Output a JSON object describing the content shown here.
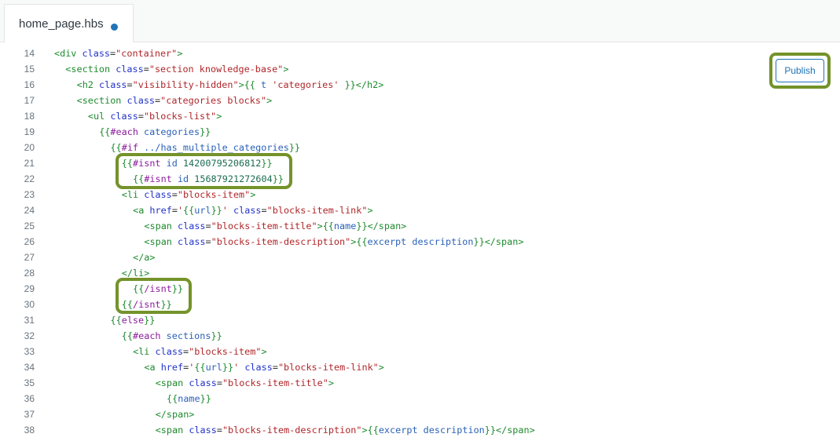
{
  "tab": {
    "filename": "home_page.hbs",
    "unsaved_indicator": "unsaved-dot"
  },
  "toolbar": {
    "publish_label": "Publish"
  },
  "colors": {
    "highlight": "#74932a",
    "accent": "#1f73b7"
  },
  "lines": [
    {
      "num": "14",
      "indent": 0,
      "tokens": [
        [
          "t",
          "<div "
        ],
        [
          "a",
          "class"
        ],
        [
          "o",
          "="
        ],
        [
          "s",
          "\"container\""
        ],
        [
          "t",
          ">"
        ]
      ]
    },
    {
      "num": "15",
      "indent": 2,
      "tokens": [
        [
          "t",
          "<section "
        ],
        [
          "a",
          "class"
        ],
        [
          "o",
          "="
        ],
        [
          "s",
          "\"section knowledge-base\""
        ],
        [
          "t",
          ">"
        ]
      ]
    },
    {
      "num": "16",
      "indent": 4,
      "tokens": [
        [
          "t",
          "<h2 "
        ],
        [
          "a",
          "class"
        ],
        [
          "o",
          "="
        ],
        [
          "s",
          "\"visibility-hidden\""
        ],
        [
          "t",
          ">"
        ],
        [
          "h",
          "{{ "
        ],
        [
          "v",
          "t "
        ],
        [
          "s",
          "'categories'"
        ],
        [
          "h",
          " }}"
        ],
        [
          "t",
          "</h2>"
        ]
      ]
    },
    {
      "num": "17",
      "indent": 4,
      "tokens": [
        [
          "t",
          "<section "
        ],
        [
          "a",
          "class"
        ],
        [
          "o",
          "="
        ],
        [
          "s",
          "\"categories blocks\""
        ],
        [
          "t",
          ">"
        ]
      ]
    },
    {
      "num": "18",
      "indent": 6,
      "tokens": [
        [
          "t",
          "<ul "
        ],
        [
          "a",
          "class"
        ],
        [
          "o",
          "="
        ],
        [
          "s",
          "\"blocks-list\""
        ],
        [
          "t",
          ">"
        ]
      ]
    },
    {
      "num": "19",
      "indent": 8,
      "tokens": [
        [
          "h",
          "{{"
        ],
        [
          "k",
          "#each "
        ],
        [
          "v",
          "categories"
        ],
        [
          "h",
          "}}"
        ]
      ]
    },
    {
      "num": "20",
      "indent": 10,
      "tokens": [
        [
          "h",
          "{{"
        ],
        [
          "k",
          "#if "
        ],
        [
          "v",
          "../has_multiple_categories"
        ],
        [
          "h",
          "}}"
        ]
      ]
    },
    {
      "num": "21",
      "indent": 12,
      "tokens": [
        [
          "h",
          "{{"
        ],
        [
          "k",
          "#isnt "
        ],
        [
          "v",
          "id "
        ],
        [
          "n",
          "14200795206812"
        ],
        [
          "h",
          "}}"
        ]
      ]
    },
    {
      "num": "22",
      "indent": 14,
      "tokens": [
        [
          "h",
          "{{"
        ],
        [
          "k",
          "#isnt "
        ],
        [
          "v",
          "id "
        ],
        [
          "n",
          "15687921272604"
        ],
        [
          "h",
          "}}"
        ]
      ]
    },
    {
      "num": "23",
      "indent": 12,
      "tokens": [
        [
          "t",
          "<li "
        ],
        [
          "a",
          "class"
        ],
        [
          "o",
          "="
        ],
        [
          "s",
          "\"blocks-item\""
        ],
        [
          "t",
          ">"
        ]
      ]
    },
    {
      "num": "24",
      "indent": 14,
      "tokens": [
        [
          "t",
          "<a "
        ],
        [
          "a",
          "href"
        ],
        [
          "o",
          "="
        ],
        [
          "s",
          "'"
        ],
        [
          "h",
          "{{"
        ],
        [
          "v",
          "url"
        ],
        [
          "h",
          "}}"
        ],
        [
          "s",
          "' "
        ],
        [
          "a",
          "class"
        ],
        [
          "o",
          "="
        ],
        [
          "s",
          "\"blocks-item-link\""
        ],
        [
          "t",
          ">"
        ]
      ]
    },
    {
      "num": "25",
      "indent": 16,
      "tokens": [
        [
          "t",
          "<span "
        ],
        [
          "a",
          "class"
        ],
        [
          "o",
          "="
        ],
        [
          "s",
          "\"blocks-item-title\""
        ],
        [
          "t",
          ">"
        ],
        [
          "h",
          "{{"
        ],
        [
          "v",
          "name"
        ],
        [
          "h",
          "}}"
        ],
        [
          "t",
          "</span>"
        ]
      ]
    },
    {
      "num": "26",
      "indent": 16,
      "tokens": [
        [
          "t",
          "<span "
        ],
        [
          "a",
          "class"
        ],
        [
          "o",
          "="
        ],
        [
          "s",
          "\"blocks-item-description\""
        ],
        [
          "t",
          ">"
        ],
        [
          "h",
          "{{"
        ],
        [
          "v",
          "excerpt description"
        ],
        [
          "h",
          "}}"
        ],
        [
          "t",
          "</span>"
        ]
      ]
    },
    {
      "num": "27",
      "indent": 14,
      "tokens": [
        [
          "t",
          "</a>"
        ]
      ]
    },
    {
      "num": "28",
      "indent": 12,
      "tokens": [
        [
          "t",
          "</li>"
        ]
      ]
    },
    {
      "num": "29",
      "indent": 14,
      "tokens": [
        [
          "h",
          "{{"
        ],
        [
          "k",
          "/isnt"
        ],
        [
          "h",
          "}}"
        ]
      ]
    },
    {
      "num": "30",
      "indent": 12,
      "tokens": [
        [
          "h",
          "{{"
        ],
        [
          "k",
          "/isnt"
        ],
        [
          "h",
          "}}"
        ]
      ]
    },
    {
      "num": "31",
      "indent": 10,
      "tokens": [
        [
          "h",
          "{{"
        ],
        [
          "k",
          "else"
        ],
        [
          "h",
          "}}"
        ]
      ]
    },
    {
      "num": "32",
      "indent": 12,
      "tokens": [
        [
          "h",
          "{{"
        ],
        [
          "k",
          "#each "
        ],
        [
          "v",
          "sections"
        ],
        [
          "h",
          "}}"
        ]
      ]
    },
    {
      "num": "33",
      "indent": 14,
      "tokens": [
        [
          "t",
          "<li "
        ],
        [
          "a",
          "class"
        ],
        [
          "o",
          "="
        ],
        [
          "s",
          "\"blocks-item\""
        ],
        [
          "t",
          ">"
        ]
      ]
    },
    {
      "num": "34",
      "indent": 16,
      "tokens": [
        [
          "t",
          "<a "
        ],
        [
          "a",
          "href"
        ],
        [
          "o",
          "="
        ],
        [
          "s",
          "'"
        ],
        [
          "h",
          "{{"
        ],
        [
          "v",
          "url"
        ],
        [
          "h",
          "}}"
        ],
        [
          "s",
          "' "
        ],
        [
          "a",
          "class"
        ],
        [
          "o",
          "="
        ],
        [
          "s",
          "\"blocks-item-link\""
        ],
        [
          "t",
          ">"
        ]
      ]
    },
    {
      "num": "35",
      "indent": 18,
      "tokens": [
        [
          "t",
          "<span "
        ],
        [
          "a",
          "class"
        ],
        [
          "o",
          "="
        ],
        [
          "s",
          "\"blocks-item-title\""
        ],
        [
          "t",
          ">"
        ]
      ]
    },
    {
      "num": "36",
      "indent": 20,
      "tokens": [
        [
          "h",
          "{{"
        ],
        [
          "v",
          "name"
        ],
        [
          "h",
          "}}"
        ]
      ]
    },
    {
      "num": "37",
      "indent": 18,
      "tokens": [
        [
          "t",
          "</span>"
        ]
      ]
    },
    {
      "num": "38",
      "indent": 18,
      "tokens": [
        [
          "t",
          "<span "
        ],
        [
          "a",
          "class"
        ],
        [
          "o",
          "="
        ],
        [
          "s",
          "\"blocks-item-description\""
        ],
        [
          "t",
          ">"
        ],
        [
          "h",
          "{{"
        ],
        [
          "v",
          "excerpt description"
        ],
        [
          "h",
          "}}"
        ],
        [
          "t",
          "</span>"
        ]
      ]
    }
  ]
}
